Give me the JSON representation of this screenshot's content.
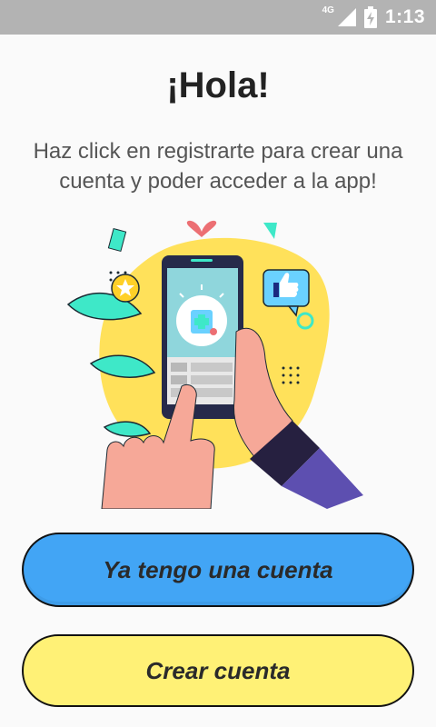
{
  "status_bar": {
    "network": "4G",
    "time": "1:13",
    "icons": [
      "signal-icon",
      "battery-charging-icon"
    ]
  },
  "header": {
    "title": "¡Hola!",
    "subtitle": "Haz click en registrarte para crear una cuenta y poder acceder a la app!"
  },
  "illustration": {
    "icons": [
      "heart-icon",
      "thumbs-up-icon",
      "star-icon",
      "medical-icon"
    ]
  },
  "buttons": {
    "login_label": "Ya tengo una cuenta",
    "register_label": "Crear cuenta"
  },
  "colors": {
    "login_button": "#42a5f5",
    "register_button": "#fff176",
    "status_bar": "#b3b3b3",
    "background": "#fafafa"
  }
}
